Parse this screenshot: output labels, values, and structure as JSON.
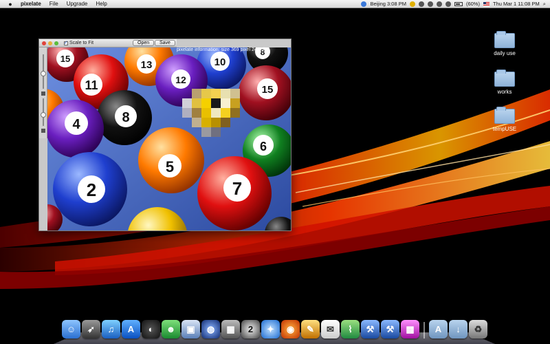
{
  "menubar": {
    "apple": "",
    "app_name": "pixelate",
    "items": [
      "File",
      "Upgrade",
      "Help"
    ],
    "clock_location": "Beijing 3:08 PM",
    "battery": "(60%)",
    "date_time": "Thu Mar 1  11:08 PM"
  },
  "window": {
    "scale_to_fit_label": "Scale to Fit",
    "scale_to_fit_checked": true,
    "open_label": "Open",
    "save_label": "Save",
    "info": "pixelate information: size 369 pixel 24 color"
  },
  "photo": {
    "balls": [
      "15",
      "13",
      "12",
      "10",
      "8",
      "11",
      "15",
      "8",
      "4",
      "5",
      "6",
      "2",
      "7"
    ]
  },
  "desktop": {
    "icons": [
      {
        "label": "daily use"
      },
      {
        "label": "works"
      },
      {
        "label": "tempUSE"
      }
    ]
  },
  "dock": {
    "icons": [
      "finder-icon",
      "rocket-icon",
      "itunes-icon",
      "app-store-icon",
      "dashboard-icon",
      "ichat-icon",
      "preview-icon",
      "google-earth-icon",
      "photo-booth-icon",
      "terminal-icon",
      "safari-icon",
      "firefox-icon",
      "keynote-icon",
      "textedit-icon",
      "maps-icon",
      "xcode-icon",
      "dev-tools-icon",
      "grid-app-icon"
    ],
    "right_icons": [
      "applications-folder-icon",
      "downloads-folder-icon",
      "trash-icon"
    ]
  },
  "colors": {
    "menubar": "#dcdcdc",
    "wallpaper_red": "#ff2a00",
    "wallpaper_orange": "#ff9a00"
  }
}
